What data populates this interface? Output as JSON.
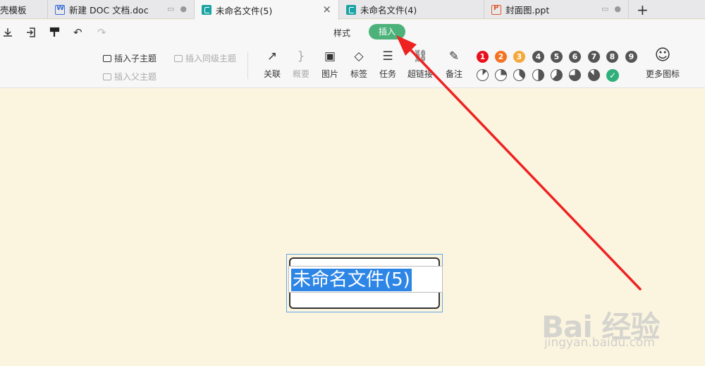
{
  "tabs": [
    {
      "label": "壳模板",
      "icon": "none"
    },
    {
      "label": "新建 DOC 文档.doc",
      "icon": "word-doc-icon"
    },
    {
      "label": "未命名文件(5)",
      "icon": "mindmap-icon",
      "active": true
    },
    {
      "label": "未命名文件(4)",
      "icon": "mindmap-icon"
    },
    {
      "label": "封面图.ppt",
      "icon": "ppt-icon"
    }
  ],
  "new_tab_label": "+",
  "tab_close_glyph": "×",
  "toolbar": {
    "undo_glyph": "↶",
    "redo_glyph": "↷",
    "ribbon_tabs": {
      "style": "样式",
      "insert": "插入"
    }
  },
  "ribbon": {
    "insert_child": "插入子主题",
    "insert_sibling": "插入同级主题",
    "insert_parent": "插入父主题",
    "tools": [
      {
        "label": "关联",
        "icon": "relation-arrow-icon",
        "glyph": "↗",
        "enabled": true
      },
      {
        "label": "概要",
        "icon": "summary-brace-icon",
        "glyph": "}",
        "enabled": false
      },
      {
        "label": "图片",
        "icon": "image-icon",
        "glyph": "▣",
        "enabled": true
      },
      {
        "label": "标签",
        "icon": "tag-icon",
        "glyph": "◇",
        "enabled": true
      },
      {
        "label": "任务",
        "icon": "task-icon",
        "glyph": "☰",
        "enabled": true
      },
      {
        "label": "超链接",
        "icon": "link-icon",
        "glyph": "⛓",
        "enabled": true
      },
      {
        "label": "备注",
        "icon": "note-icon",
        "glyph": "✎",
        "enabled": true
      }
    ],
    "priority_icons": [
      {
        "label": "1",
        "color": "#e8101c"
      },
      {
        "label": "2",
        "color": "#f4721f"
      },
      {
        "label": "3",
        "color": "#f5a83a"
      },
      {
        "label": "4",
        "color": "#555555"
      },
      {
        "label": "5",
        "color": "#555555"
      },
      {
        "label": "6",
        "color": "#555555"
      },
      {
        "label": "7",
        "color": "#555555"
      },
      {
        "label": "8",
        "color": "#555555"
      },
      {
        "label": "9",
        "color": "#555555"
      }
    ],
    "progress_icons": [
      0.125,
      0.25,
      0.375,
      0.5,
      0.625,
      0.75,
      0.875
    ],
    "done_glyph": "✓",
    "smiley_glyph": "☺",
    "more_icons": "更多图标"
  },
  "canvas": {
    "topic_text": "未命名文件(5)"
  },
  "watermark": {
    "brand": "Bai 经验",
    "url": "jingyan.baidu.com"
  },
  "colors": {
    "canvas_bg": "#fbf5df",
    "accent": "#4cb27a",
    "selection": "#2d86e6",
    "arrow": "#ee2222"
  }
}
